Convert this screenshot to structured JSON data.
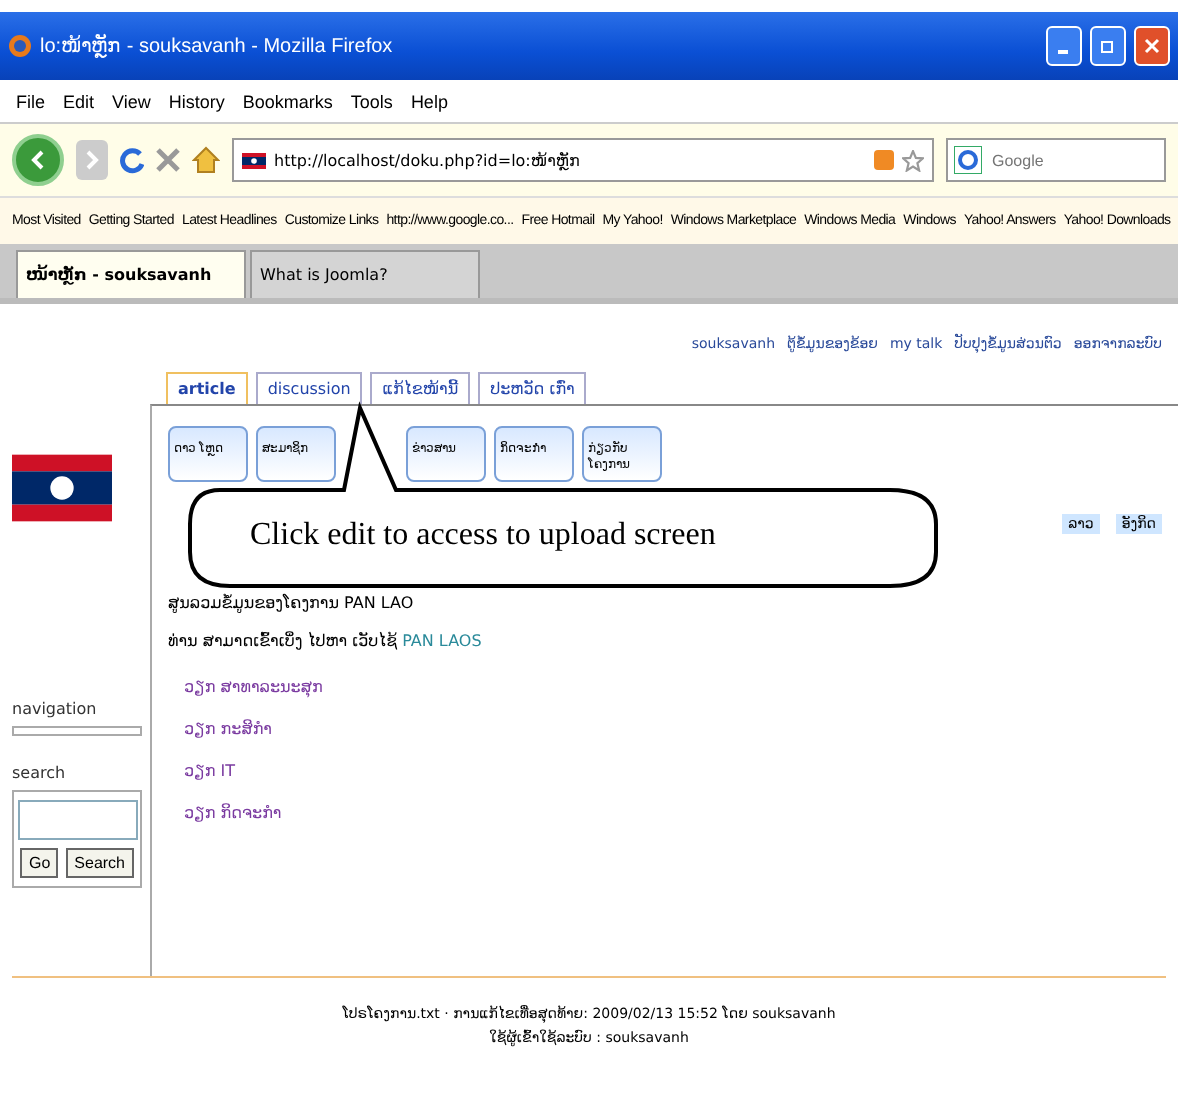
{
  "window": {
    "title": "lo:ໜ້າຫຼັກ - souksavanh - Mozilla Firefox"
  },
  "menu": [
    "File",
    "Edit",
    "View",
    "History",
    "Bookmarks",
    "Tools",
    "Help"
  ],
  "address": {
    "value": "http://localhost/doku.php?id=lo:ໜ້າຫຼັກ"
  },
  "web_search": {
    "placeholder": "Google"
  },
  "bookmarks": [
    "Most Visited",
    "Getting Started",
    "Latest Headlines",
    "Customize Links",
    "http://www.google.co...",
    "Free Hotmail",
    "My Yahoo!",
    "Windows Marketplace",
    "Windows Media",
    "Windows",
    "Yahoo! Answers",
    "Yahoo! Downloads"
  ],
  "browser_tabs": [
    {
      "label": "ໜ້າຫຼັກ - souksavanh",
      "selected": true
    },
    {
      "label": "What is Joomla?",
      "selected": false
    }
  ],
  "user_links": [
    "souksavanh",
    "ຕູ້ຂໍ້ມູນຂອງຂ້ອຍ",
    "my talk",
    "ປັບປຸງຂໍ້ມູນສ່ວນຕົວ",
    "ອອກຈາກລະບົບ"
  ],
  "page_tabs": [
    {
      "label": "article",
      "selected": true
    },
    {
      "label": "discussion",
      "selected": false
    },
    {
      "label": "ແກ້ໄຂໜ້ານີ້",
      "selected": false
    },
    {
      "label": "ປະຫວັດ ເກົ່າ",
      "selected": false
    }
  ],
  "toolbar_buttons": [
    "ດາວ ໂຫຼດ",
    "ສະມາຊິກ",
    "ຂ່າວສານ",
    "ກິດຈະກຳ",
    "ກ່ຽວກັບ ໂຄງການ"
  ],
  "callout": "Click edit to access to upload screen",
  "languages": [
    "ລາວ",
    "ອັງກິດ"
  ],
  "sidebar": {
    "navigation": "navigation",
    "search": "search",
    "go": "Go",
    "search_button": "Search"
  },
  "content": {
    "heading": "ສູນລວມຂໍ້ມູນຂອງໂຄງການ PAN LAO",
    "intro": "ທ່ານ ສາມາດເຂົ້າເບິ່ງ ໄປຫາ ເວັບໄຊ້",
    "intro_link": "PAN LAOS",
    "items": [
      "ວຽກ ສາທາລະນະສຸກ",
      "ວຽກ ກະສິກຳ",
      "ວຽກ IT",
      "ວຽກ ກິດຈະກຳ"
    ]
  },
  "footer": [
    "ໂປຣໂຄງການ.txt · ການແກ້ໄຂເທື່ອສຸດທ້າຍ: 2009/02/13 15:52 ໂດຍ souksavanh",
    "ໃຊ້ຜູ້ເຂົ້າໃຊ້ລະບົບ : souksavanh"
  ]
}
